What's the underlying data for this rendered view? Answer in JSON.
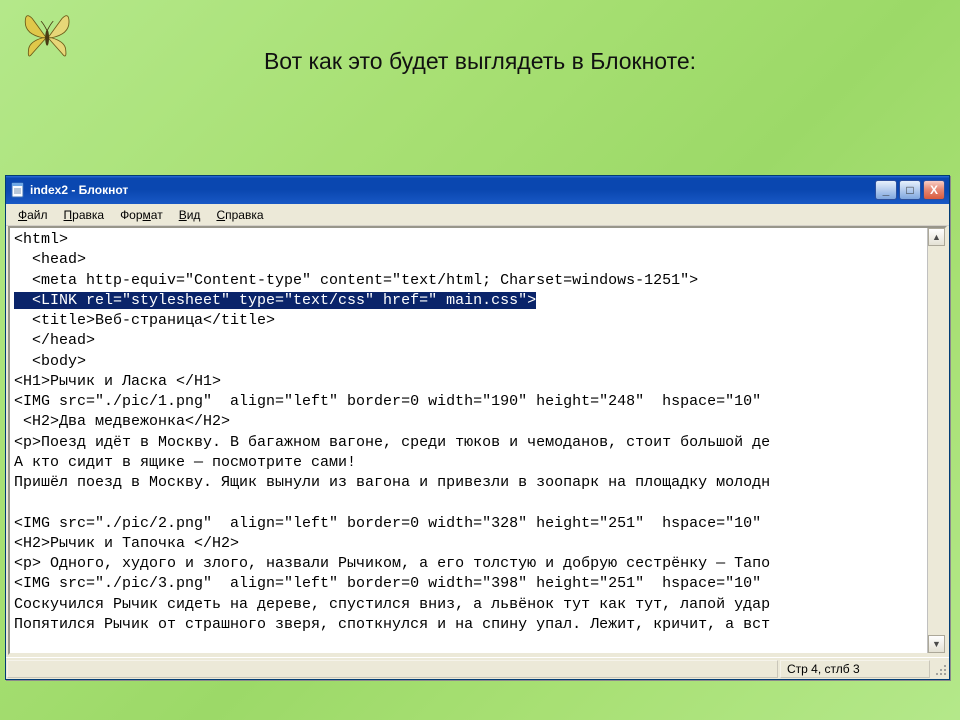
{
  "slide": {
    "caption": "Вот как это будет выглядеть в Блокноте:"
  },
  "window": {
    "title": "index2 - Блокнот",
    "controls": {
      "minimize": "_",
      "maximize": "□",
      "close": "X"
    }
  },
  "menu": {
    "file": {
      "label": "Файл",
      "ul": "Ф"
    },
    "edit": {
      "label": "Правка",
      "ul": "П"
    },
    "format": {
      "label": "Формат",
      "ul": ""
    },
    "view": {
      "label": "Вид",
      "ul": "В"
    },
    "help": {
      "label": "Справка",
      "ul": "С"
    }
  },
  "text": {
    "l1": "<html>",
    "l2": "  <head>",
    "l3": "  <meta http-equiv=\"Content-type\" content=\"text/html; Charset=windows-1251\">",
    "l4sel": "  <LINK rel=\"stylesheet\" type=\"text/css\" href=\" main.css\">",
    "l5": "  <title>Веб-страница</title>",
    "l6": "  </head>",
    "l7": "  <body>",
    "l8": "<H1>Рычик и Ласка </H1>",
    "l9": "<IMG src=\"./pic/1.png\"  align=\"left\" border=0 width=\"190\" height=\"248\"  hspace=\"10\" ",
    "l10": " <H2>Два медвежонка</H2>",
    "l11": "<p>Поезд идёт в Москву. В багажном вагоне, среди тюков и чемоданов, стоит большой де",
    "l12": "А кто сидит в ящике — посмотрите сами!",
    "l13": "Пришёл поезд в Москву. Ящик вынули из вагона и привезли в зоопарк на площадку молодн",
    "l14": "",
    "l15": "<IMG src=\"./pic/2.png\"  align=\"left\" border=0 width=\"328\" height=\"251\"  hspace=\"10\" ",
    "l16": "<H2>Рычик и Тапочка </H2>",
    "l17": "<p> Одного, худого и злого, назвали Рычиком, а его толстую и добрую сестрёнку — Тапо",
    "l18": "<IMG src=\"./pic/3.png\"  align=\"left\" border=0 width=\"398\" height=\"251\"  hspace=\"10\" ",
    "l19": "Соскучился Рычик сидеть на дереве, спустился вниз, а львёнок тут как тут, лапой удар",
    "l20": "Попятился Рычик от страшного зверя, споткнулся и на спину упал. Лежит, кричит, а вст"
  },
  "status": {
    "pos": "Стр 4, стлб 3"
  }
}
